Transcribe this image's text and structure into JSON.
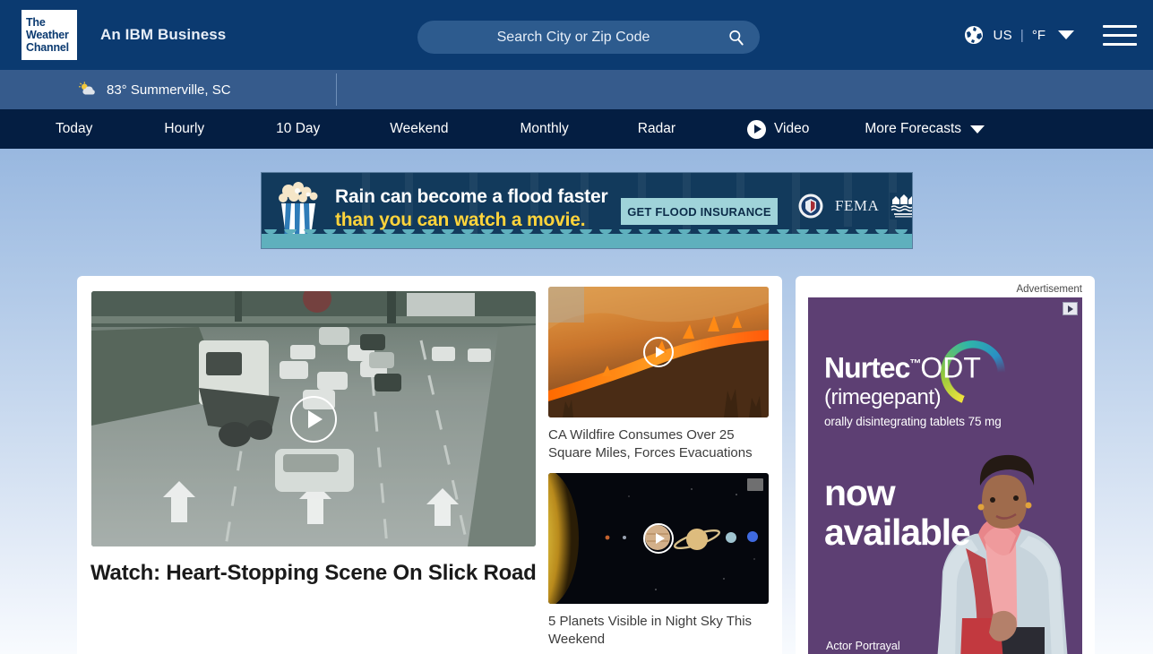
{
  "brand": {
    "logo_line1": "The",
    "logo_line2": "Weather",
    "logo_line3": "Channel",
    "tagline": "An IBM Business"
  },
  "search": {
    "placeholder": "Search City or Zip Code",
    "value": "",
    "icon": "search-icon"
  },
  "header_right": {
    "globe_icon": "globe-icon",
    "region": "US",
    "separator": "|",
    "unit": "°F",
    "chevron_icon": "chevron-down-icon",
    "menu_icon": "hamburger-menu-icon"
  },
  "location_bar": {
    "weather_icon": "sun-behind-cloud-icon",
    "temperature": "83°",
    "place": "Summerville, SC",
    "full_text": "83° Summerville, SC"
  },
  "nav": {
    "items": [
      {
        "label": "Today",
        "icon": null,
        "caret": false
      },
      {
        "label": "Hourly",
        "icon": null,
        "caret": false
      },
      {
        "label": "10 Day",
        "icon": null,
        "caret": false
      },
      {
        "label": "Weekend",
        "icon": null,
        "caret": false
      },
      {
        "label": "Monthly",
        "icon": null,
        "caret": false
      },
      {
        "label": "Radar",
        "icon": null,
        "caret": false
      },
      {
        "label": "Video",
        "icon": "play-icon",
        "caret": false
      },
      {
        "label": "More Forecasts",
        "icon": null,
        "caret": true
      }
    ]
  },
  "banner_ad": {
    "headline_line1": "Rain can become a flood faster",
    "headline_line2": "than you can watch a movie.",
    "cta_label": "GET FLOOD INSURANCE",
    "brand": "FEMA",
    "secondary_logo": "national-flood-insurance-program-logo",
    "icon": "popcorn-bucket-in-flood-icon"
  },
  "main": {
    "hero": {
      "title": "Watch: Heart-Stopping Scene On Slick Road",
      "media": "traffic-camera-highway-crash-video",
      "play_icon": "play-icon"
    },
    "side_cards": [
      {
        "caption": "CA Wildfire Consumes Over 25 Square Miles, Forces Evacuations",
        "media": "california-wildfire-video",
        "play_icon": "play-icon"
      },
      {
        "caption": "5 Planets Visible in Night Sky This Weekend",
        "media": "solar-system-planets-video",
        "play_icon": "play-icon"
      }
    ]
  },
  "ad_panel": {
    "label": "Advertisement",
    "adchoices_icon": "adchoices-icon",
    "creative": {
      "brand_name": "Nurtec",
      "trademark": "™",
      "brand_suffix": "ODT",
      "generic_name": "(rimegepant)",
      "description": "orally disintegrating tablets 75 mg",
      "headline_line1": "now",
      "headline_line2": "available",
      "disclaimer": "Actor Portrayal"
    }
  },
  "colors": {
    "header_navy": "#0b3a70",
    "nav_navy": "#041e42",
    "location_blue": "#365b8c",
    "search_field": "#2d5b8e",
    "page_top": "#7ba3d8",
    "page_bottom": "#f8fbfe",
    "fema_navy": "#123a5c",
    "fema_yellow": "#ffd43b",
    "fema_teal": "#9fd3d9",
    "ad_purple": "#5d3f73",
    "card_white": "#ffffff",
    "headline_text": "#1a1a1a",
    "caption_text": "#3c3c3c"
  }
}
